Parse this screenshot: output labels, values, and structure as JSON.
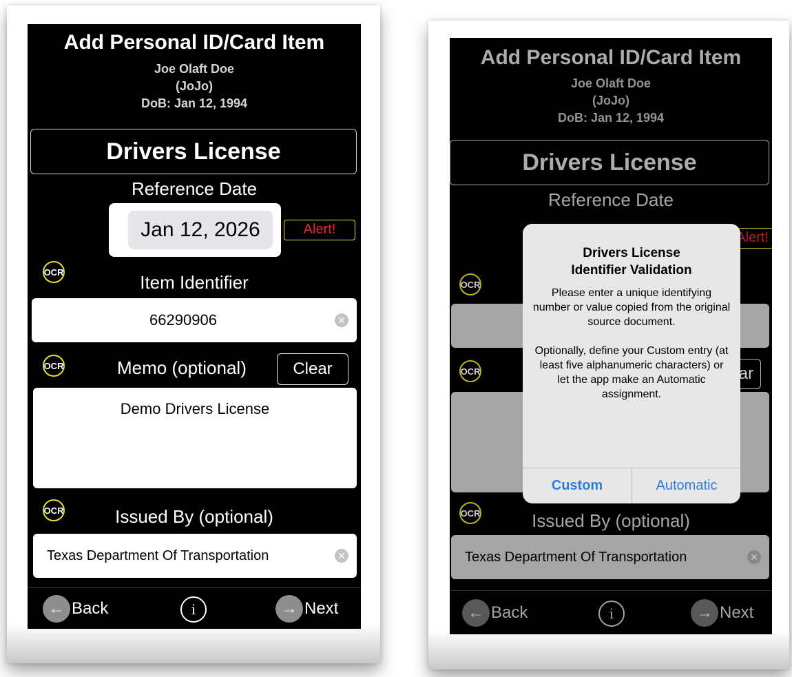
{
  "screen": {
    "title": "Add Personal ID/Card Item",
    "person_name": "Joe Olaft Doe",
    "nickname": "(JoJo)",
    "dob": "DoB: Jan 12, 1994",
    "item_type": "Drivers License",
    "reference_date_label": "Reference Date",
    "reference_date_value": "Jan 12, 2026",
    "alert_label": "Alert!",
    "ocr_label": "OCR",
    "item_identifier_label": "Item Identifier",
    "item_identifier_value": "66290906",
    "memo_label": "Memo (optional)",
    "clear_label": "Clear",
    "memo_value": "Demo Drivers License",
    "issued_by_label": "Issued By (optional)",
    "issued_by_value": "Texas Department Of Transportation",
    "back_label": "Back",
    "next_label": "Next",
    "info_glyph": "i",
    "clear_glyph": "✕",
    "back_glyph": "←",
    "next_glyph": "→"
  },
  "dialog": {
    "title": "Drivers License\nIdentifier Validation",
    "message": "Please enter a unique identifying number or value copied from the original source document.\n\nOptionally, define your Custom entry (at least five alphanumeric characters) or let the app make an Automatic assignment.",
    "custom_label": "Custom",
    "automatic_label": "Automatic"
  },
  "colors": {
    "background": "#000000",
    "alert_text": "#e8262a",
    "ocr_ring": "#e8e030",
    "dialog_button": "#2a7ee0"
  },
  "icons": [
    "ocr-icon",
    "clear-icon",
    "back-arrow-icon",
    "next-arrow-icon",
    "info-icon"
  ]
}
